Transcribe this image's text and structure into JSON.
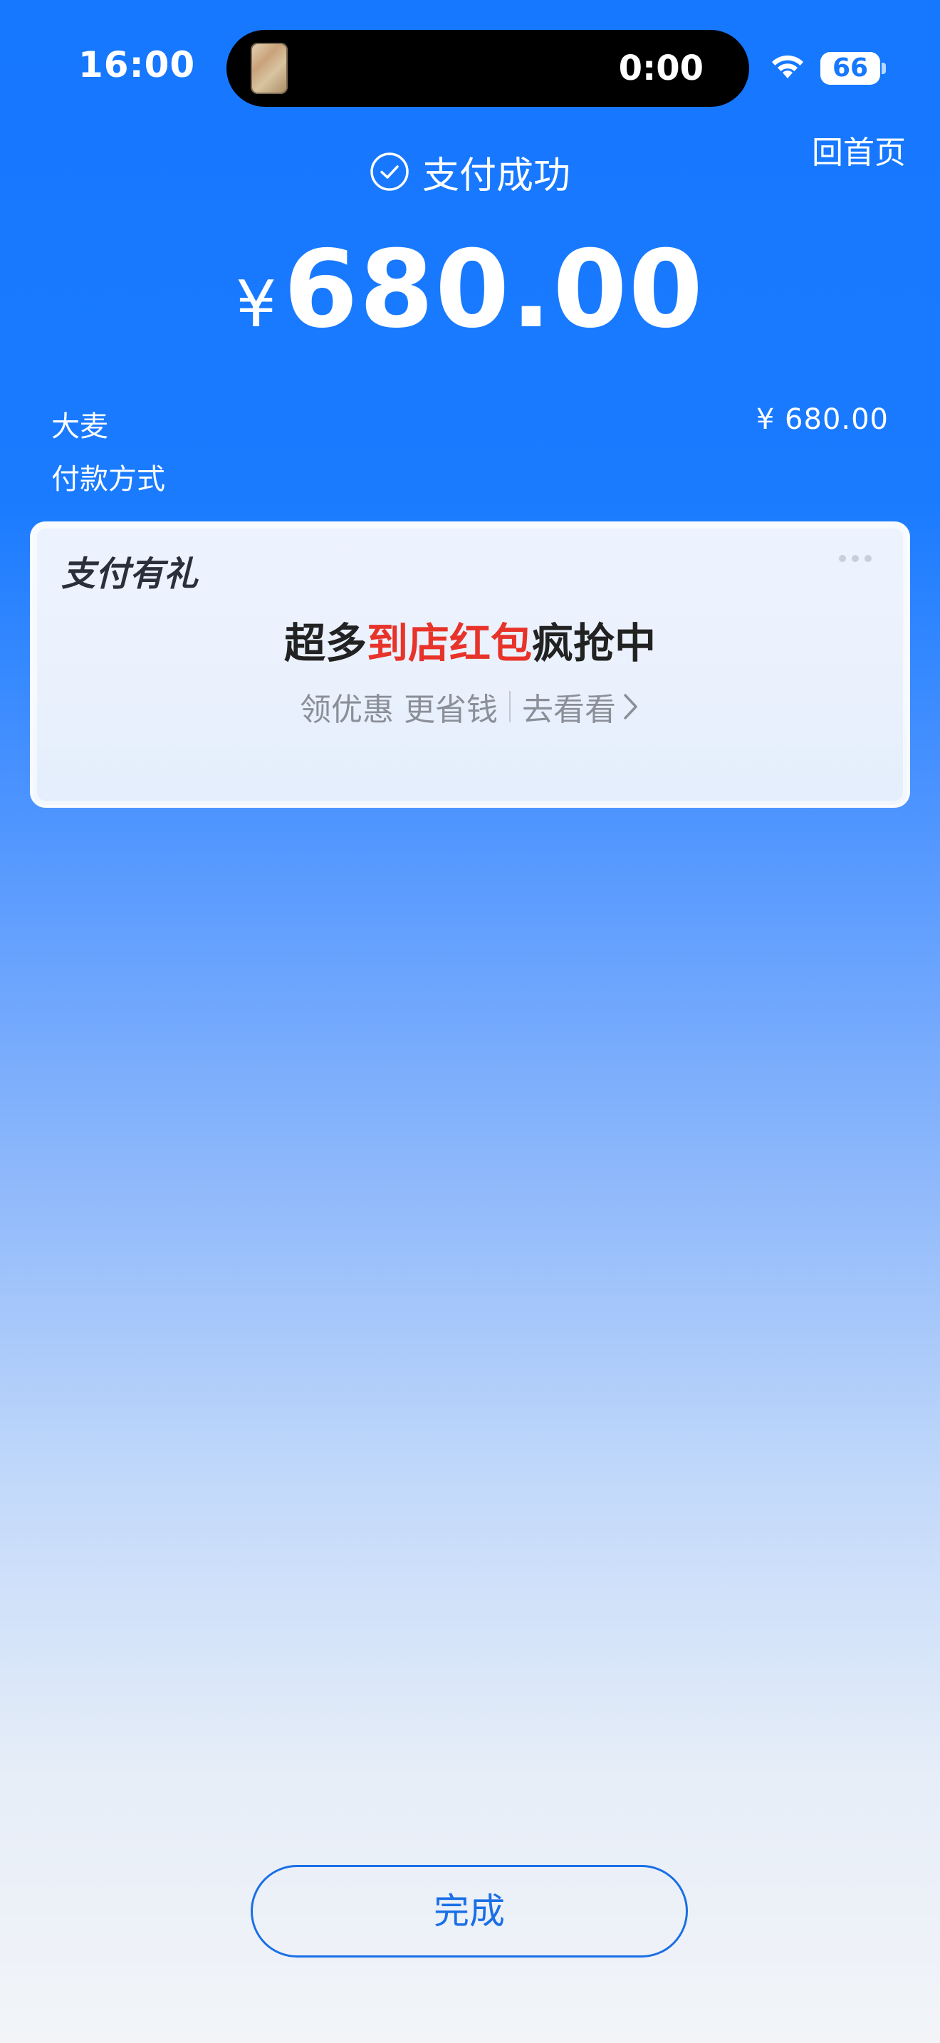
{
  "status_bar": {
    "time": "16:00",
    "live_activity_timer": "0:00",
    "battery_percent": "66",
    "battery_level": 0.66,
    "icons": [
      "wifi-icon",
      "battery-icon",
      "app-thumbnail-icon"
    ]
  },
  "header": {
    "home_link": "回首页",
    "status_text": "支付成功",
    "status_icon": "check-circle-icon"
  },
  "payment": {
    "currency_symbol": "¥",
    "amount": "680.00"
  },
  "details": {
    "merchant_label": "大麦",
    "merchant_amount": "¥ 680.00",
    "payment_method_label": "付款方式"
  },
  "promo": {
    "title": "支付有礼",
    "headline_prefix": "超多",
    "headline_highlight": "到店红包",
    "headline_suffix": "疯抢中",
    "subtitle": "领优惠 更省钱",
    "cta": "去看看",
    "highlight_color": "#e8332a"
  },
  "footer": {
    "done_label": "完成"
  },
  "colors": {
    "accent": "#1677ff",
    "button_border": "#1a6fe6"
  }
}
